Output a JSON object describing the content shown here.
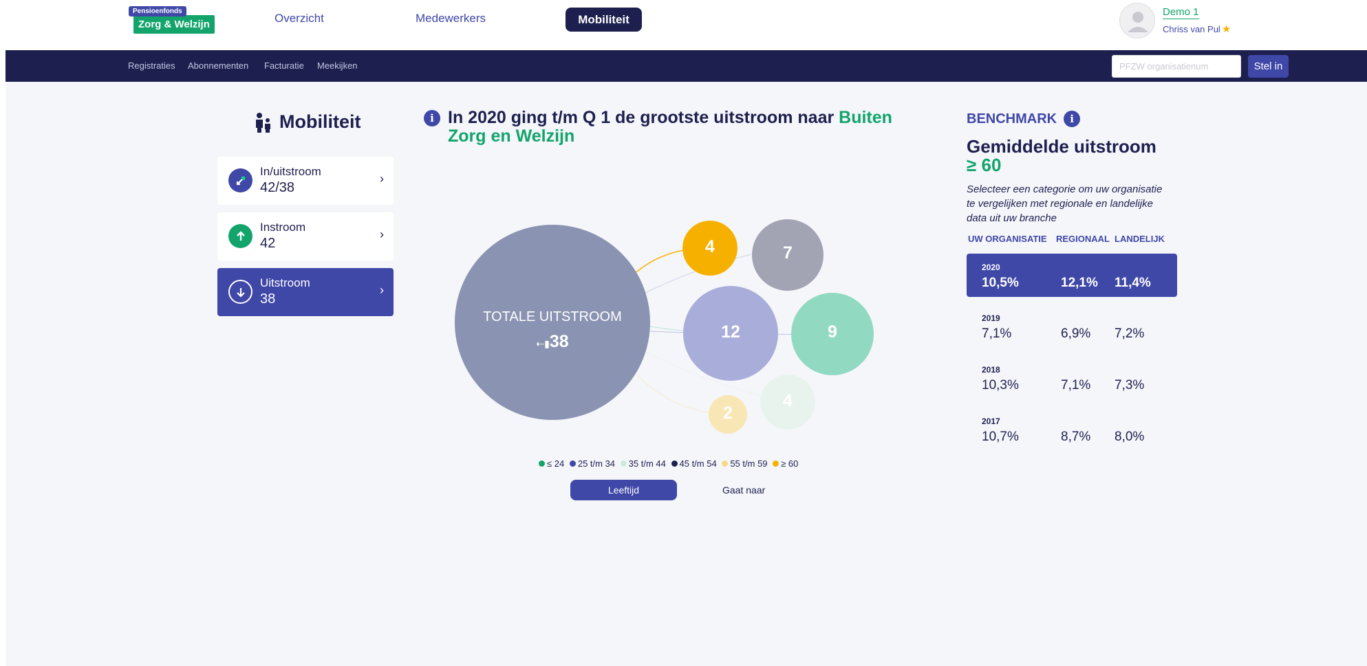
{
  "header": {
    "logo_top": "Pensioenfonds",
    "logo_main": "Zorg & Welzijn",
    "nav": [
      "Overzicht",
      "Medewerkers"
    ],
    "nav_active": "Mobiliteit",
    "user_org": "Demo 1",
    "user_name": "Chriss van Pul"
  },
  "subnav": {
    "items": [
      "Registraties",
      "Abonnementen",
      "Facturatie",
      "Meekijken"
    ],
    "search_placeholder": "PFZW organisatienum",
    "button": "Stel in"
  },
  "left": {
    "title": "Mobiliteit",
    "cards": [
      {
        "label": "In/uitstroom",
        "value": "42/38"
      },
      {
        "label": "Instroom",
        "value": "42"
      },
      {
        "label": "Uitstroom",
        "value": "38"
      }
    ]
  },
  "center": {
    "headline": "In 2020 ging t/m Q 1 de grootste uitstroom naar ",
    "headline_green": "Buiten Zorg en Welzijn",
    "total_label": "TOTALE UITSTROOM",
    "total_value": "38",
    "bubbles": [
      {
        "value": "4",
        "color": "#f6b100"
      },
      {
        "value": "7",
        "color": "#a2a3b3"
      },
      {
        "value": "12",
        "color": "#a9add9"
      },
      {
        "value": "9",
        "color": "#92d9c2"
      },
      {
        "value": "4",
        "color": "#e8f3ee"
      },
      {
        "value": "2",
        "color": "#f8e7b5"
      }
    ],
    "legend": [
      {
        "label": "≤ 24",
        "color": "#12a46b"
      },
      {
        "label": "25 t/m 34",
        "color": "#3f47a7"
      },
      {
        "label": "35 t/m 44",
        "color": "#cfe9df"
      },
      {
        "label": "45 t/m 54",
        "color": "#1d1f4e"
      },
      {
        "label": "55 t/m 59",
        "color": "#f8d987"
      },
      {
        "label": "≥ 60",
        "color": "#f6b100"
      }
    ],
    "toggle_active": "Leeftijd",
    "toggle": "Gaat naar"
  },
  "benchmark": {
    "label": "BENCHMARK",
    "title": "Gemiddelde uitstroom",
    "title_green": "≥ 60",
    "description": "Selecteer een categorie om uw organisatie te vergelijken met regionale en landelijke data uit uw branche",
    "columns": [
      "UW ORGANISATIE",
      "REGIONAAL",
      "LANDELIJK"
    ],
    "rows": [
      {
        "year": "2020",
        "org": "10,5%",
        "regional": "12,1%",
        "national": "11,4%"
      },
      {
        "year": "2019",
        "org": "7,1%",
        "regional": "6,9%",
        "national": "7,2%"
      },
      {
        "year": "2018",
        "org": "10,3%",
        "regional": "7,1%",
        "national": "7,3%"
      },
      {
        "year": "2017",
        "org": "10,7%",
        "regional": "8,7%",
        "national": "8,0%"
      }
    ]
  }
}
